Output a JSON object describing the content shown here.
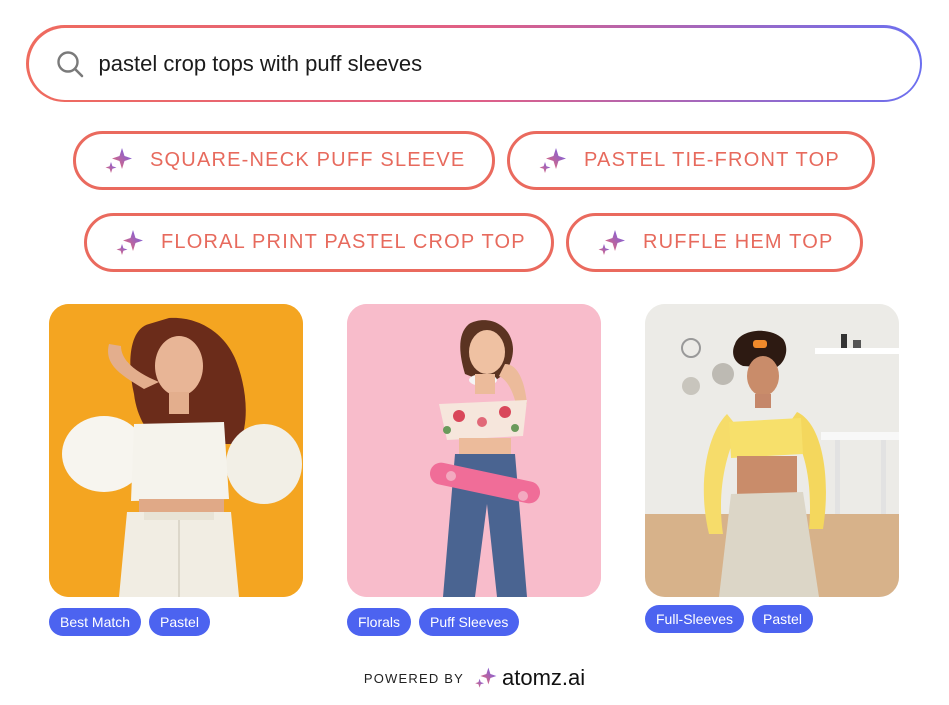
{
  "search": {
    "query": "pastel crop tops with puff sleeves"
  },
  "suggestions": [
    "SQUARE-NECK PUFF SLEEVE",
    "PASTEL TIE-FRONT TOP",
    "FLORAL PRINT PASTEL CROP TOP",
    "RUFFLE HEM TOP"
  ],
  "products": [
    {
      "tags": [
        "Best Match",
        "Pastel"
      ],
      "bg": "#f5a623"
    },
    {
      "tags": [
        "Florals",
        "Puff Sleeves"
      ],
      "bg": "#f7b8c8"
    },
    {
      "tags": [
        "Full-Sleeves",
        "Pastel"
      ],
      "bg": "#eceae6"
    }
  ],
  "footer": {
    "powered_by": "POWERED BY",
    "brand": "atomz.ai"
  },
  "colors": {
    "accent_coral": "#ea6a5e",
    "tag_blue": "#4c63f0",
    "spark_purple": "#7b5cf0"
  }
}
